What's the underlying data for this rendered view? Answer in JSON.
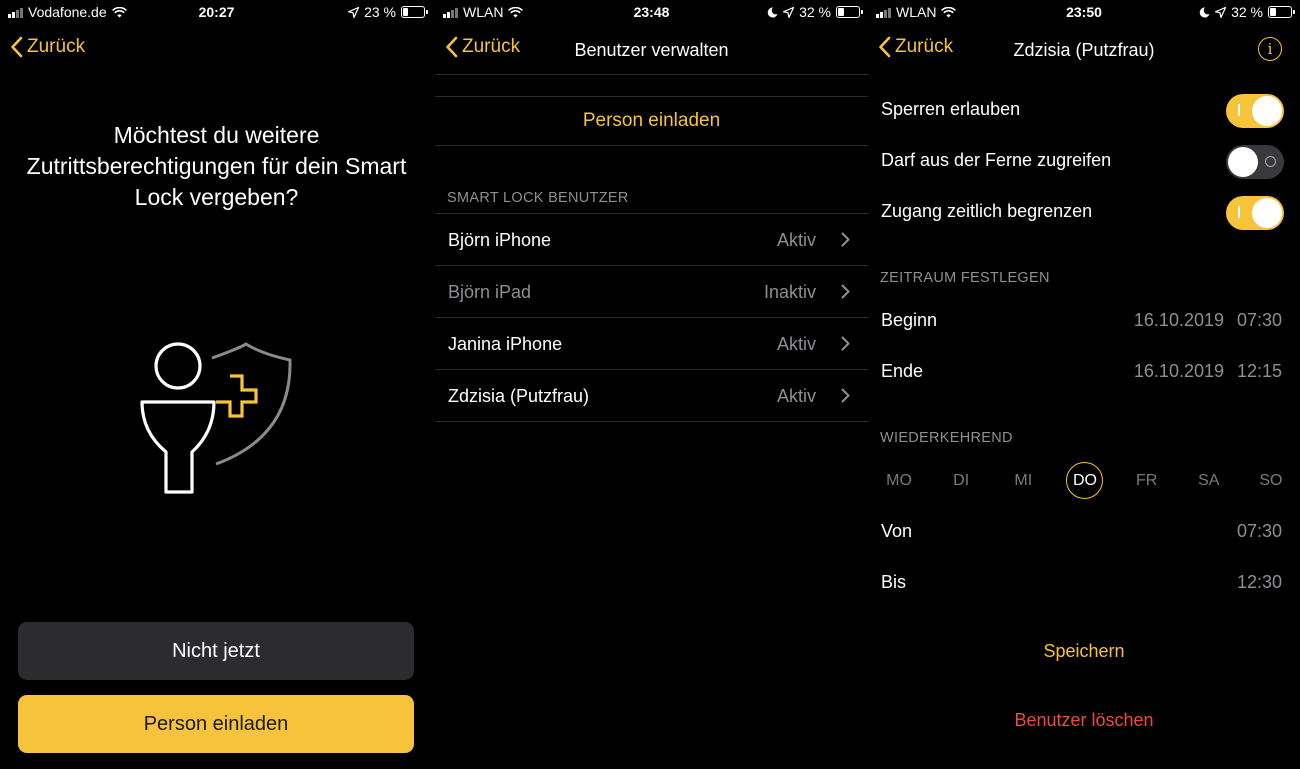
{
  "colors": {
    "accent": "#f6c33a",
    "danger": "#ec4a45",
    "dim": "#8e8e93"
  },
  "screen1": {
    "status": {
      "carrier": "Vodafone.de",
      "time": "20:27",
      "battery": "23 %",
      "battery_level": 0.23
    },
    "nav": {
      "back_label": "Zurück"
    },
    "question": "Möchtest du weitere Zutrittsberechtigungen für dein Smart Lock vergeben?",
    "illustration_icon": "person-shield-plus-icon",
    "not_now_label": "Nicht jetzt",
    "invite_label": "Person einladen"
  },
  "screen2": {
    "status": {
      "carrier": "WLAN",
      "time": "23:48",
      "battery": "32 %",
      "battery_level": 0.32
    },
    "nav": {
      "back_label": "Zurück",
      "title": "Benutzer verwalten"
    },
    "invite_label": "Person einladen",
    "section_header": "SMART LOCK BENUTZER",
    "users": [
      {
        "name": "Björn iPhone",
        "status": "Aktiv",
        "dim": false
      },
      {
        "name": "Björn iPad",
        "status": "Inaktiv",
        "dim": true
      },
      {
        "name": "Janina iPhone",
        "status": "Aktiv",
        "dim": false
      },
      {
        "name": "Zdzisia (Putzfrau)",
        "status": "Aktiv",
        "dim": false
      }
    ]
  },
  "screen3": {
    "status": {
      "carrier": "WLAN",
      "time": "23:50",
      "battery": "32 %",
      "battery_level": 0.32
    },
    "nav": {
      "back_label": "Zurück",
      "title": "Zdzisia (Putzfrau)"
    },
    "toggles": [
      {
        "label": "Sperren erlauben",
        "on": true
      },
      {
        "label": "Darf aus der Ferne zugreifen",
        "on": false
      },
      {
        "label": "Zugang zeitlich begrenzen",
        "on": true
      }
    ],
    "period_header": "ZEITRAUM FESTLEGEN",
    "begin": {
      "label": "Beginn",
      "date": "16.10.2019",
      "time": "07:30"
    },
    "end": {
      "label": "Ende",
      "date": "16.10.2019",
      "time": "12:15"
    },
    "recurring_header": "WIEDERKEHREND",
    "days": [
      "MO",
      "DI",
      "MI",
      "DO",
      "FR",
      "SA",
      "SO"
    ],
    "selected_day": "DO",
    "from": {
      "label": "Von",
      "time": "07:30"
    },
    "to": {
      "label": "Bis",
      "time": "12:30"
    },
    "save_label": "Speichern",
    "delete_label": "Benutzer löschen"
  }
}
